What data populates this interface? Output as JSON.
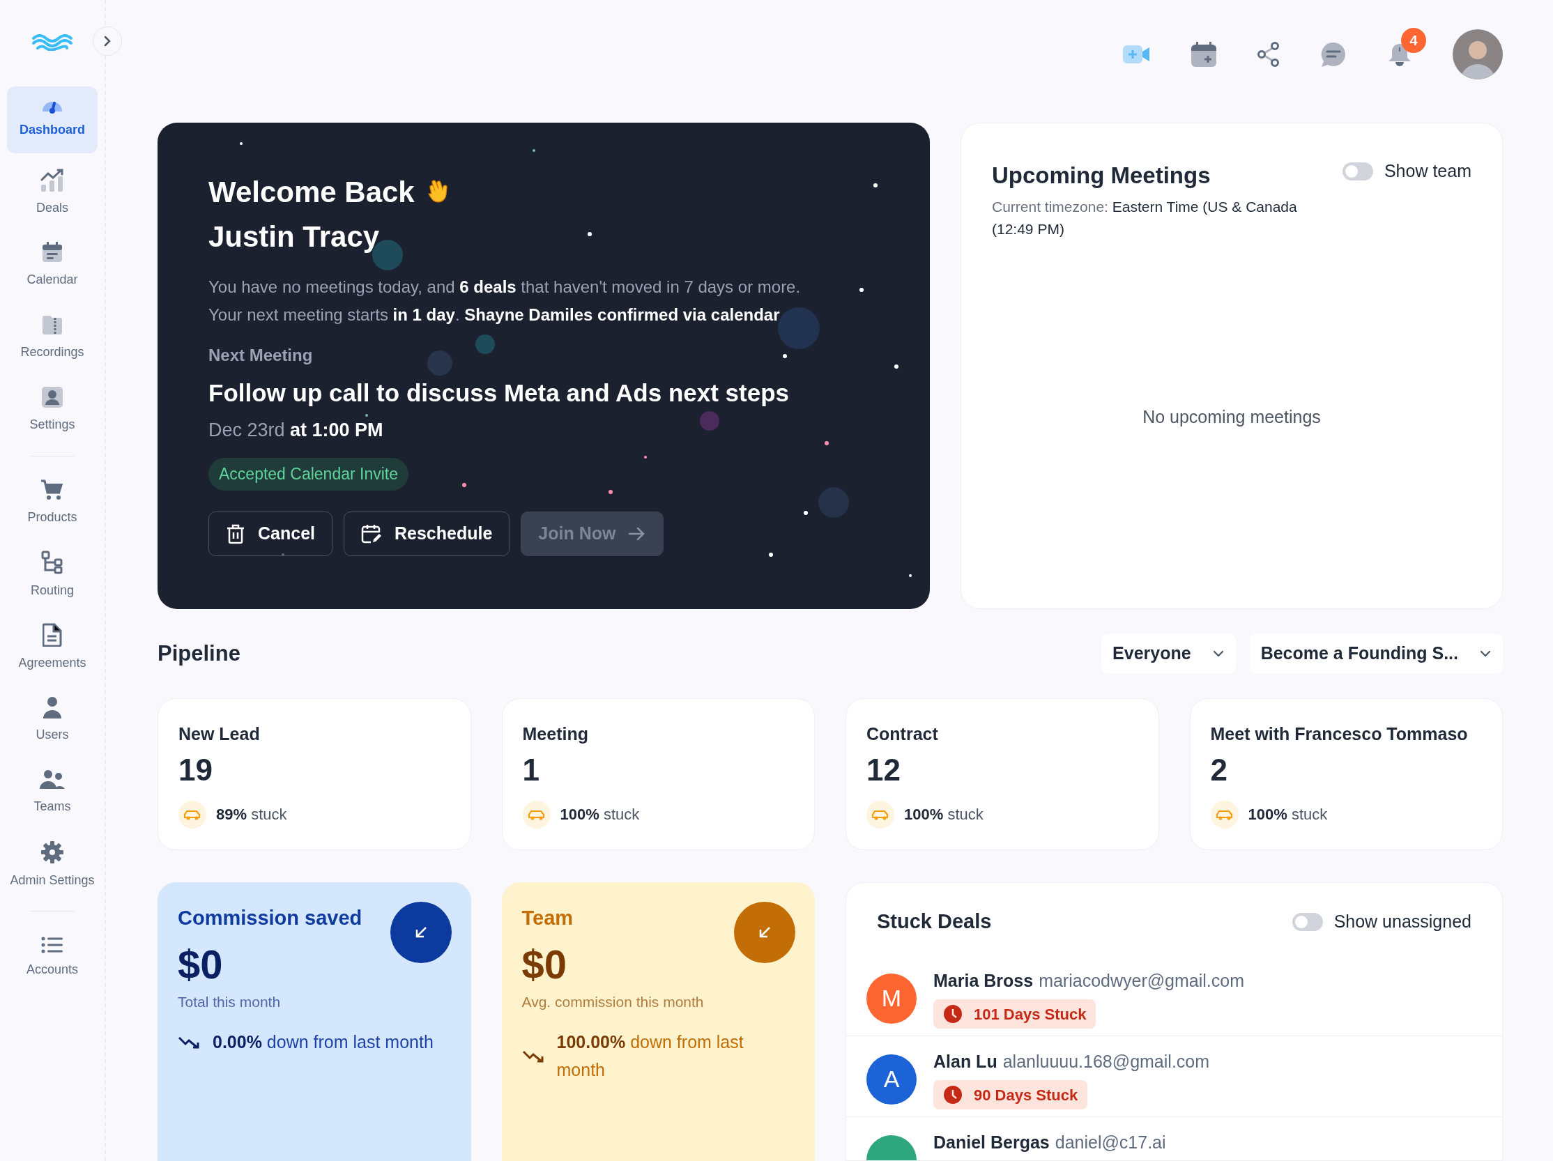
{
  "sidebar": {
    "sections": [
      {
        "items": [
          {
            "label": "Dashboard",
            "selected": true
          },
          {
            "label": "Deals",
            "selected": false
          },
          {
            "label": "Calendar",
            "selected": false
          },
          {
            "label": "Recordings",
            "selected": false
          },
          {
            "label": "Settings",
            "selected": false
          }
        ]
      },
      {
        "items": [
          {
            "label": "Products",
            "selected": false
          },
          {
            "label": "Routing",
            "selected": false
          },
          {
            "label": "Agreements",
            "selected": false
          },
          {
            "label": "Users",
            "selected": false
          },
          {
            "label": "Teams",
            "selected": false
          },
          {
            "label": "Admin Settings",
            "selected": false
          }
        ]
      },
      {
        "items": [
          {
            "label": "Accounts",
            "selected": false
          }
        ]
      }
    ]
  },
  "top_bar": {
    "notification_count": "4"
  },
  "welcome": {
    "greeting": "Welcome Back",
    "name": "Justin Tracy",
    "summary": "You have no meetings today, and **6 deals** that haven't moved in 7 days or more.",
    "next_line": "Your next meeting starts **in 1 day**. **Shayne Damiles confirmed via calendar**",
    "next_label": "Next Meeting",
    "meeting_title": "Follow up call to discuss Meta and Ads next steps",
    "meeting_time": "Dec 23rd **at 1:00 PM**",
    "status_badge": "Accepted Calendar Invite",
    "buttons": [
      {
        "label": "Cancel",
        "kind": "cancel",
        "disabled": false
      },
      {
        "label": "Reschedule",
        "kind": "reschedule",
        "disabled": false
      },
      {
        "label": "Join Now",
        "kind": "join",
        "disabled": true
      }
    ]
  },
  "meetings": {
    "title": "Upcoming Meetings",
    "show_team": {
      "label": "Show team",
      "on": false
    },
    "timezone_label": "Current timezone:",
    "timezone": "Eastern Time (US & Canada",
    "time": "(12:49 PM)",
    "empty_text": "No upcoming meetings"
  },
  "pipeline": {
    "title": "Pipeline",
    "filters": [
      {
        "label": "Everyone"
      },
      {
        "label": "Become a Founding S..."
      }
    ],
    "stages": [
      {
        "name": "New Lead",
        "count": "19",
        "stuck": "**89%** stuck"
      },
      {
        "name": "Meeting",
        "count": "1",
        "stuck": "**100%** stuck"
      },
      {
        "name": "Contract",
        "count": "12",
        "stuck": "**100%** stuck"
      },
      {
        "name": "Meet with Francesco Tommaso",
        "count": "2",
        "stuck": "**100%** stuck"
      }
    ]
  },
  "stats": [
    {
      "kind": "blue",
      "title": "Commission saved",
      "value": "$0",
      "caption": "Total this month",
      "change": "**0.00%** down from last month"
    },
    {
      "kind": "amber",
      "title": "Team",
      "value": "$0",
      "caption": "Avg. commission this month",
      "change": "**100.00%** down from last month"
    }
  ],
  "stuck_deals": {
    "title": "Stuck Deals",
    "show_unassigned": {
      "label": "Show unassigned",
      "on": false
    },
    "deals": [
      {
        "initial": "M",
        "color": "#fe6631",
        "name": "Maria Bross",
        "email": "mariacodwyer@gmail.com",
        "stuck": "101 Days Stuck"
      },
      {
        "initial": "A",
        "color": "#1d63d8",
        "name": "Alan Lu",
        "email": "alanluuuu.168@gmail.com",
        "stuck": "90 Days Stuck"
      },
      {
        "color": "#2fa77e",
        "name": "Daniel Bergas",
        "email": "daniel@c17.ai"
      }
    ]
  }
}
